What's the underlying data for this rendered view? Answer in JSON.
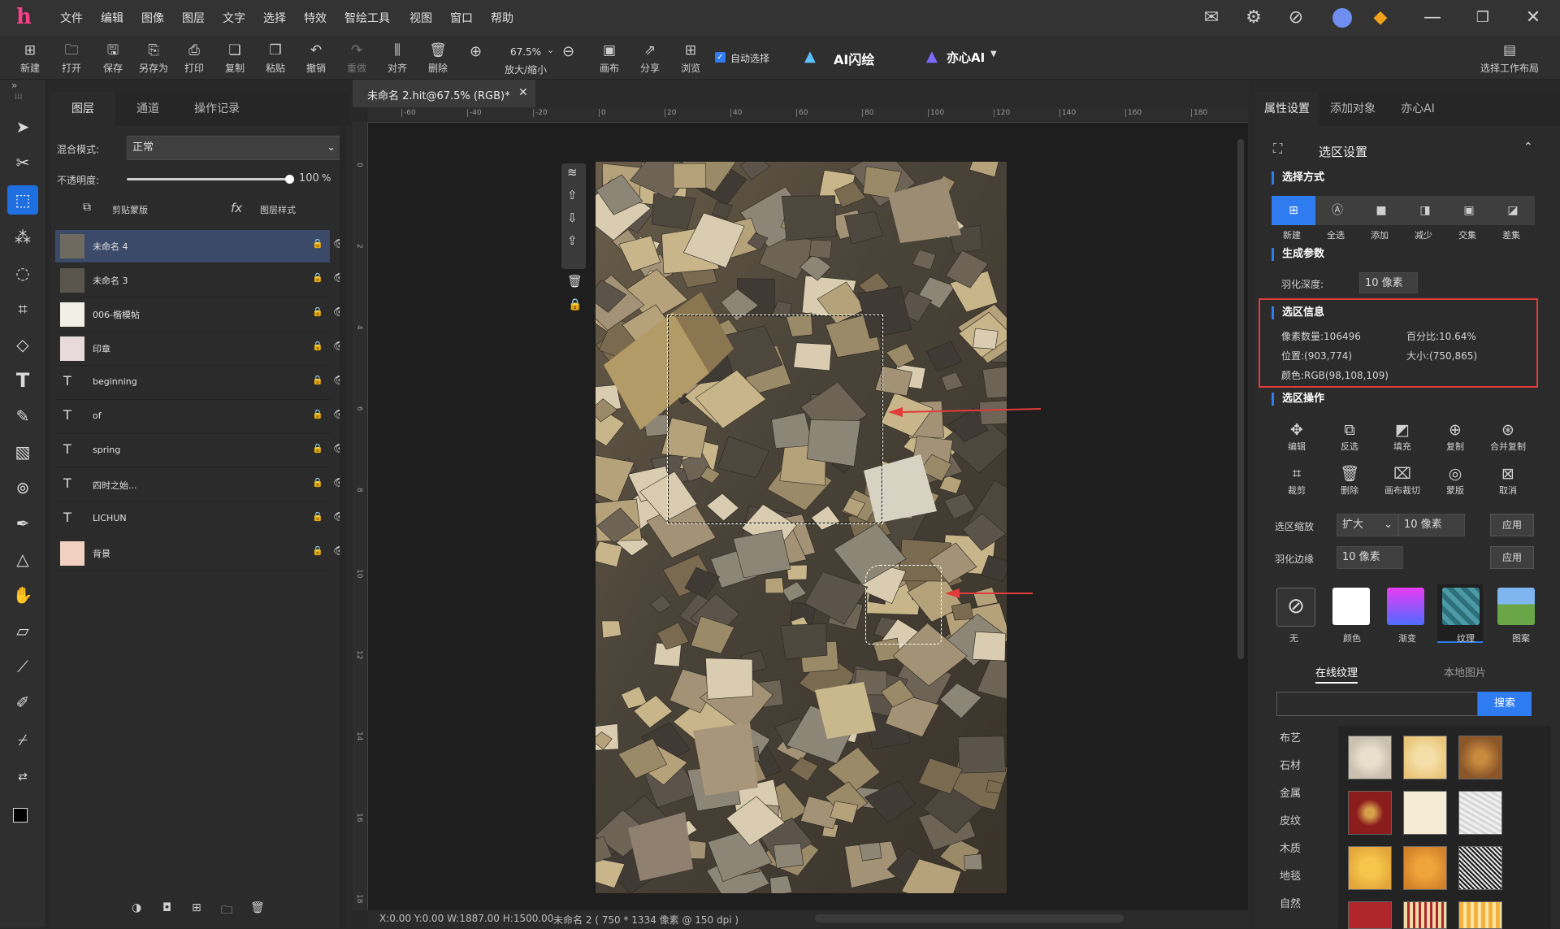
{
  "menu": [
    "文件",
    "编辑",
    "图像",
    "图层",
    "文字",
    "选择",
    "特效",
    "智绘工具",
    "视图",
    "窗口",
    "帮助"
  ],
  "toolbar": {
    "new": "新建",
    "open": "打开",
    "save": "保存",
    "save_as": "另存为",
    "print": "打印",
    "copy": "复制",
    "paste": "粘贴",
    "undo": "撤销",
    "redo": "重做",
    "align": "对齐",
    "delete": "删除",
    "zoom_value": "67.5%",
    "zoom_label": "放大/缩小",
    "canvas": "画布",
    "share": "分享",
    "browse": "浏览",
    "auto_select": "自动选择",
    "ai_flash": "AI闪绘",
    "yixin_ai": "亦心AI",
    "workspace": "选择工作布局"
  },
  "layers_panel": {
    "tabs": [
      "图层",
      "通道",
      "操作记录"
    ],
    "blend_label": "混合模式:",
    "blend_value": "正常",
    "opacity_label": "不透明度:",
    "opacity_value": "100",
    "opacity_unit": "%",
    "opacity_fraction": 1.0,
    "clip_label": "剪贴蒙版",
    "style_label": "图层样式",
    "layers": [
      {
        "name": "未命名 4",
        "kind": "image",
        "selected": true
      },
      {
        "name": "未命名 3",
        "kind": "image",
        "selected": false
      },
      {
        "name": "006-楷模帖",
        "kind": "image",
        "selected": false
      },
      {
        "name": "印章",
        "kind": "image",
        "selected": false
      },
      {
        "name": "beginning",
        "kind": "text",
        "selected": false
      },
      {
        "name": "of",
        "kind": "text",
        "selected": false
      },
      {
        "name": "spring",
        "kind": "text",
        "selected": false
      },
      {
        "name": "四时之始...",
        "kind": "text",
        "selected": false
      },
      {
        "name": "LICHUN",
        "kind": "text",
        "selected": false
      },
      {
        "name": "背景",
        "kind": "image",
        "selected": false
      }
    ]
  },
  "document": {
    "tab_title": "未命名 2.hit@67.5% (RGB)*",
    "ruler_top": [
      "-60",
      "-40",
      "-20",
      "0",
      "20",
      "40",
      "60",
      "80",
      "100",
      "120",
      "140",
      "160",
      "180"
    ],
    "ruler_left": [
      "0",
      "2",
      "4",
      "6",
      "8",
      "10",
      "12",
      "14",
      "16",
      "18"
    ],
    "status_coords": "X:0.00 Y:0.00 W:1887.00 H:1500.00",
    "status_doc": "未命名 2 ( 750 * 1334 像素 @ 150 dpi )"
  },
  "right_panel": {
    "tabs": [
      "属性设置",
      "添加对象",
      "亦心AI"
    ],
    "section_title": "选区设置",
    "select_mode_title": "选择方式",
    "select_modes": [
      "新建",
      "全选",
      "添加",
      "减少",
      "交集",
      "差集"
    ],
    "gen_params_title": "生成参数",
    "feather_label": "羽化深度:",
    "feather_value": "10 像素",
    "info_title": "选区信息",
    "pixel_count": "像素数量:106496",
    "percent": "百分比:10.64%",
    "position": "位置:(903,774)",
    "size": "大小:(750,865)",
    "color": "颜色:RGB(98,108,109)",
    "ops_title": "选区操作",
    "ops_row1": [
      "编辑",
      "反选",
      "填充",
      "复制",
      "合并复制"
    ],
    "ops_row2": [
      "裁剪",
      "删除",
      "画布裁切",
      "蒙版",
      "取消"
    ],
    "scale_label": "选区缩放",
    "scale_mode": "扩大",
    "scale_value": "10 像素",
    "apply": "应用",
    "edge_label": "羽化边缘",
    "edge_value": "10 像素",
    "fill_types": [
      "无",
      "颜色",
      "渐变",
      "纹理",
      "图案"
    ],
    "texture_tabs": [
      "在线纹理",
      "本地图片"
    ],
    "search_placeholder": "",
    "search_button": "搜索",
    "categories": [
      "布艺",
      "石材",
      "金属",
      "皮纹",
      "木质",
      "地毯",
      "自然"
    ]
  },
  "colors": {
    "accent": "#2f7bf0",
    "highlight_box": "#e23b3b",
    "arrow": "#e23b3b"
  }
}
